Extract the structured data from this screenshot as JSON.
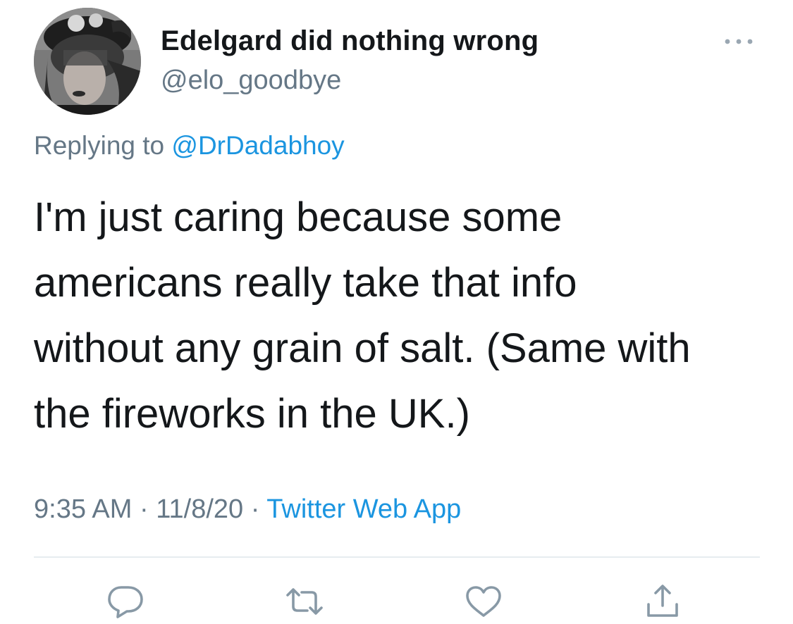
{
  "user": {
    "display_name": "Edelgard did nothing wrong",
    "handle": "@elo_goodbye",
    "avatar_icon": "profile-photo"
  },
  "reply_context": {
    "prefix": "Replying to",
    "mention": "@DrDadabhoy"
  },
  "tweet": {
    "text": "I'm just caring because some\namericans really take that info\nwithout any grain of salt. (Same with\nthe fireworks in the UK.)"
  },
  "meta": {
    "time": "9:35 AM",
    "separator": "·",
    "date": "11/8/20",
    "source": "Twitter Web App"
  },
  "actions": {
    "reply_icon": "comment-bubble-icon",
    "retweet_icon": "retweet-arrows-icon",
    "like_icon": "heart-icon",
    "share_icon": "share-upload-icon",
    "more_icon": "ellipsis-icon"
  },
  "colors": {
    "text": "#14171a",
    "secondary": "#657786",
    "link": "#1b95e0",
    "divider": "#e6ecf0"
  }
}
